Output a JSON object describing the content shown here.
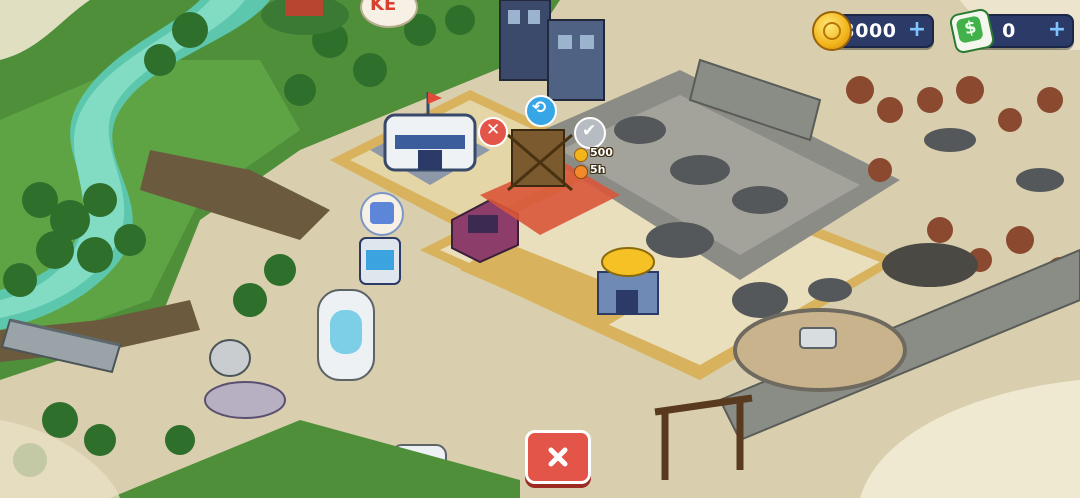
{
  "hud": {
    "coins": {
      "value": "3000",
      "icon": "coin-icon"
    },
    "cash": {
      "value": "0",
      "icon": "cash-icon"
    }
  },
  "map": {
    "sign_text": "KE",
    "upgrade_site": {
      "coin_cost": "500",
      "time_cost": "5h"
    }
  },
  "buttons": {
    "close": {
      "icon": "close-icon"
    }
  },
  "colors": {
    "hud_bg": "#2b3a66",
    "close_red": "#e25548",
    "grass": "#5aa040",
    "river": "#5cc7ad",
    "road": "#d8b25d"
  }
}
